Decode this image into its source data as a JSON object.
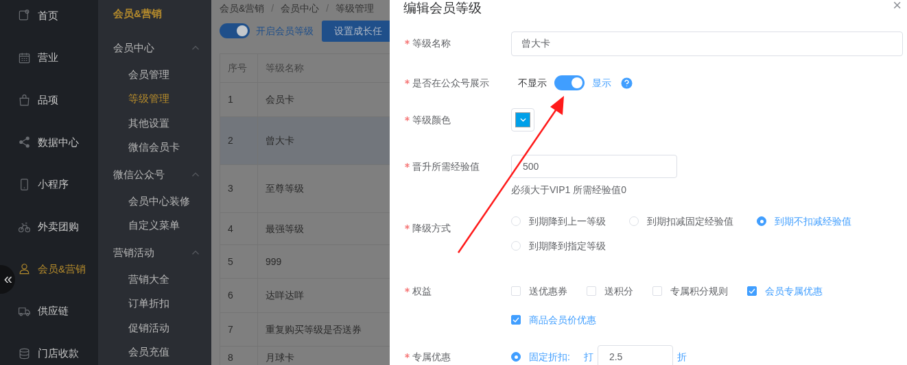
{
  "nav": {
    "items": [
      {
        "label": "首页",
        "selected": false
      },
      {
        "label": "营业",
        "selected": false
      },
      {
        "label": "品项",
        "selected": false
      },
      {
        "label": "数据中心",
        "selected": false
      },
      {
        "label": "小程序",
        "selected": false
      },
      {
        "label": "外卖团购",
        "selected": false
      },
      {
        "label": "会员&营销",
        "selected": true
      },
      {
        "label": "供应链",
        "selected": false
      },
      {
        "label": "门店收款",
        "selected": false
      }
    ],
    "collapse": "«"
  },
  "subnav": {
    "title": "会员&营销",
    "groups": [
      {
        "label": "会员中心",
        "expanded": true,
        "children": [
          {
            "label": "会员管理",
            "selected": false
          },
          {
            "label": "等级管理",
            "selected": true
          },
          {
            "label": "其他设置",
            "selected": false
          },
          {
            "label": "微信会员卡",
            "selected": false
          }
        ]
      },
      {
        "label": "微信公众号",
        "expanded": true,
        "children": [
          {
            "label": "会员中心装修",
            "selected": false
          },
          {
            "label": "自定义菜单",
            "selected": false
          }
        ]
      },
      {
        "label": "营销活动",
        "expanded": true,
        "children": [
          {
            "label": "营销大全",
            "selected": false
          },
          {
            "label": "订单折扣",
            "selected": false
          },
          {
            "label": "促销活动",
            "selected": false
          },
          {
            "label": "会员充值",
            "selected": false
          }
        ]
      }
    ]
  },
  "breadcrumb": [
    {
      "kind": "link",
      "text": "会员&营销"
    },
    {
      "kind": "separator",
      "text": "/"
    },
    {
      "kind": "link",
      "text": "会员中心"
    },
    {
      "kind": "separator",
      "text": "/"
    },
    {
      "kind": "link",
      "text": "等级管理"
    }
  ],
  "level_switch": {
    "label": "开启会员等级",
    "on": true
  },
  "growth_button": "设置成长任",
  "table": {
    "columns": [
      "序号",
      "等级名称"
    ],
    "rows": [
      {
        "cells": [
          "1",
          "会员卡"
        ],
        "highlighted": false
      },
      {
        "cells": [
          "2",
          "曾大卡"
        ],
        "highlighted": true
      },
      {
        "cells": [
          "3",
          "至尊等级"
        ],
        "highlighted": false
      },
      {
        "cells": [
          "4",
          "最强等级"
        ],
        "highlighted": false
      },
      {
        "cells": [
          "5",
          "999"
        ],
        "highlighted": false
      },
      {
        "cells": [
          "6",
          "达咩达咩"
        ],
        "highlighted": false
      },
      {
        "cells": [
          "7",
          "重复购买等级是否送券"
        ],
        "highlighted": false
      },
      {
        "cells": [
          "8",
          "月球卡"
        ],
        "highlighted": false
      }
    ]
  },
  "drawer": {
    "title": "编辑会员等级",
    "close": "×",
    "level_name": {
      "label": "等级名称",
      "required": true,
      "value": "曾大卡"
    },
    "display": {
      "label": "是否在公众号展示",
      "required": true,
      "off_label": "不显示",
      "on_label": "显示",
      "on": true
    },
    "color": {
      "label": "等级颜色",
      "required": true,
      "color": "#00a0e9"
    },
    "exp": {
      "label": "晋升所需经验值",
      "required": true,
      "value": "500",
      "hint": "必须大于VIP1 所需经验值0"
    },
    "downgrade": {
      "label": "降级方式",
      "required": true,
      "options": [
        {
          "label": "到期降到上一等级",
          "selected": false
        },
        {
          "label": "到期扣减固定经验值",
          "selected": false
        },
        {
          "label": "到期不扣减经验值",
          "selected": true
        },
        {
          "label": "到期降到指定等级",
          "selected": false
        }
      ]
    },
    "rights": {
      "label": "权益",
      "required": true,
      "options": [
        {
          "label": "送优惠券",
          "checked": false
        },
        {
          "label": "送积分",
          "checked": false
        },
        {
          "label": "专属积分规则",
          "checked": false
        },
        {
          "label": "会员专属优惠",
          "checked": true
        },
        {
          "label": "商品会员价优惠",
          "checked": true
        }
      ]
    },
    "exclusive": {
      "label": "专属优惠",
      "required": true,
      "options": [
        {
          "label": "固定折扣:",
          "selected": true
        }
      ],
      "prefix": "打",
      "value": "2.5",
      "suffix": "折"
    }
  }
}
